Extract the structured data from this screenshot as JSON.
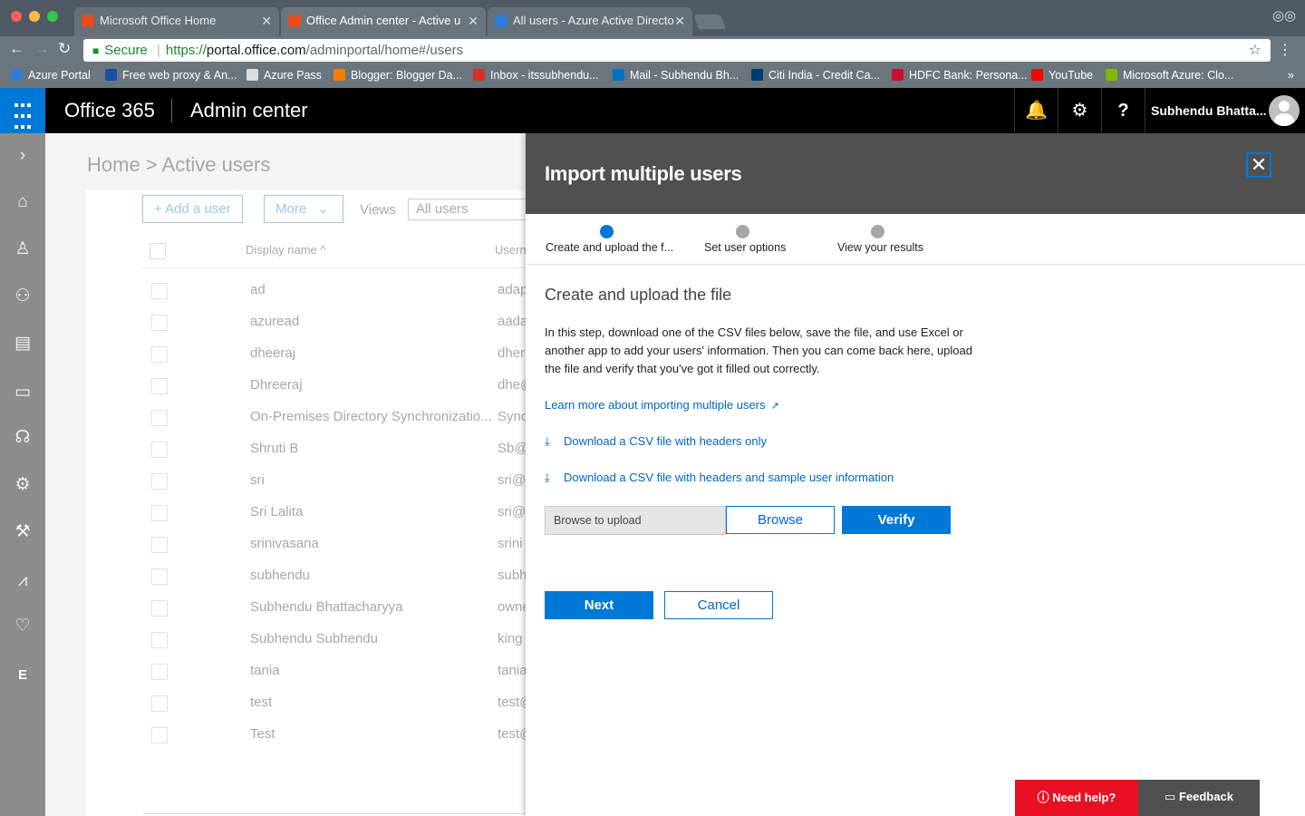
{
  "browser": {
    "tabs": [
      {
        "title": "Microsoft Office Home",
        "active": false,
        "fav_color": "#e84c1e"
      },
      {
        "title": "Office Admin center - Active u",
        "active": true,
        "fav_color": "#e84c1e"
      },
      {
        "title": "All users - Azure Active Directo",
        "active": false,
        "fav_color": "#2f7dd6"
      }
    ],
    "address": {
      "secure_label": "Secure",
      "scheme": "https://",
      "host": "portal.office.com",
      "path": "/adminportal/home#/users"
    },
    "bookmarks": [
      {
        "label": "Azure Portal",
        "color": "#2f7dd6"
      },
      {
        "label": "Free web proxy & An...",
        "color": "#1a4fa3"
      },
      {
        "label": "Azure Pass",
        "color": "#dddddd"
      },
      {
        "label": "Blogger: Blogger Da...",
        "color": "#f57d00"
      },
      {
        "label": "Inbox - itssubhendu...",
        "color": "#d93025"
      },
      {
        "label": "Mail - Subhendu Bh...",
        "color": "#0072c6"
      },
      {
        "label": "Citi India - Credit Ca...",
        "color": "#003b70"
      },
      {
        "label": "HDFC Bank: Persona...",
        "color": "#c8102e"
      },
      {
        "label": "YouTube",
        "color": "#ff0000"
      },
      {
        "label": "Microsoft Azure: Clo...",
        "color": "#7fba00"
      }
    ]
  },
  "header": {
    "brand": "Office 365",
    "app": "Admin center",
    "user": "Subhendu Bhatta..."
  },
  "page": {
    "breadcrumb": "Home > Active users",
    "add_user": "Add a user",
    "more": "More",
    "views_label": "Views",
    "views_value": "All users",
    "col_display_name": "Display name",
    "col_username": "Userna",
    "users": [
      {
        "name": "ad",
        "user": "adap"
      },
      {
        "name": "azuread",
        "user": "aada"
      },
      {
        "name": "dheeraj",
        "user": "dher"
      },
      {
        "name": "Dhreeraj",
        "user": "dhe@"
      },
      {
        "name": "On-Premises Directory Synchronizatio...",
        "user": "Sync"
      },
      {
        "name": "Shruti B",
        "user": "Sb@"
      },
      {
        "name": "sri",
        "user": "sri@"
      },
      {
        "name": "Sri Lalita",
        "user": "sri@"
      },
      {
        "name": "srinivasana",
        "user": "srini"
      },
      {
        "name": "subhendu",
        "user": "subh"
      },
      {
        "name": "Subhendu Bhattacharyya",
        "user": "owne"
      },
      {
        "name": "Subhendu Subhendu",
        "user": "king"
      },
      {
        "name": "tania",
        "user": "tania"
      },
      {
        "name": "test",
        "user": "test@"
      },
      {
        "name": "Test",
        "user": "test@"
      }
    ]
  },
  "panel": {
    "title": "Import multiple users",
    "steps": [
      {
        "label": "Create and upload the f...",
        "current": true
      },
      {
        "label": "Set user options",
        "current": false
      },
      {
        "label": "View your results",
        "current": false
      }
    ],
    "section_title": "Create and upload the file",
    "description": "In this step, download one of the CSV files below, save the file, and use Excel or another app to add your users' information. Then you can come back here, upload the file and verify that you've got it filled out correctly.",
    "learn_more": "Learn more about importing multiple users",
    "download_headers": "Download a CSV file with headers only",
    "download_sample": "Download a CSV file with headers and sample user information",
    "upload_placeholder": "Browse to upload",
    "browse": "Browse",
    "verify": "Verify",
    "next": "Next",
    "cancel": "Cancel"
  },
  "help": {
    "need_help": "Need help?",
    "feedback": "Feedback"
  }
}
